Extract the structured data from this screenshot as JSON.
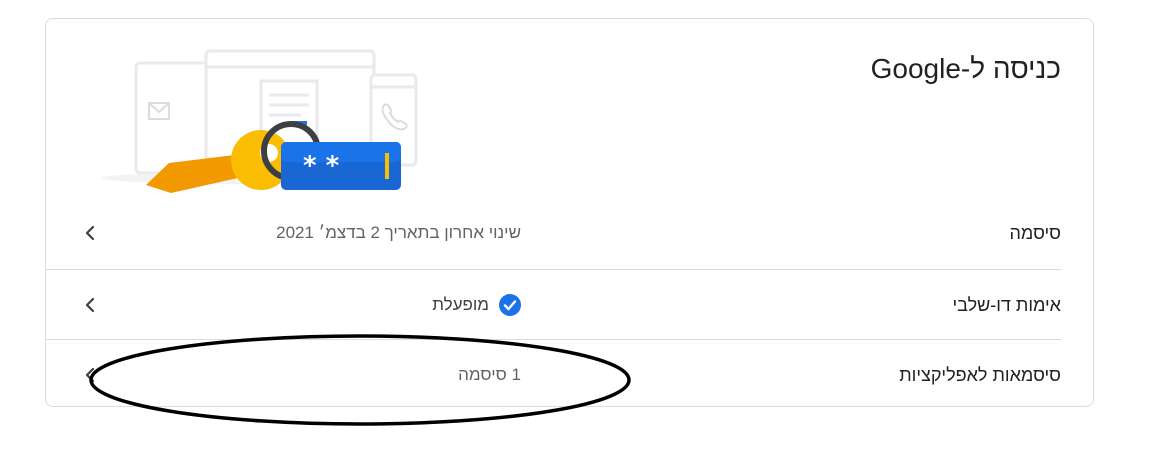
{
  "card": {
    "title": "כניסה ל-Google"
  },
  "rows": [
    {
      "label": "סיסמה",
      "value": "שינוי אחרון בתאריך 2 בדצמ׳ 2021",
      "chevron": "chevron-left-icon"
    },
    {
      "label": "אימות דו-שלבי",
      "value": "מופעלת",
      "status_icon": "check-circle-icon",
      "status_color": "#1a73e8",
      "chevron": "chevron-left-icon"
    },
    {
      "label": "סיסמאות לאפליקציות",
      "value": "1 סיסמה",
      "chevron": "chevron-left-icon"
    }
  ],
  "colors": {
    "accent": "#1a73e8",
    "key": "#fbbc04",
    "divider": "#dadce0"
  }
}
